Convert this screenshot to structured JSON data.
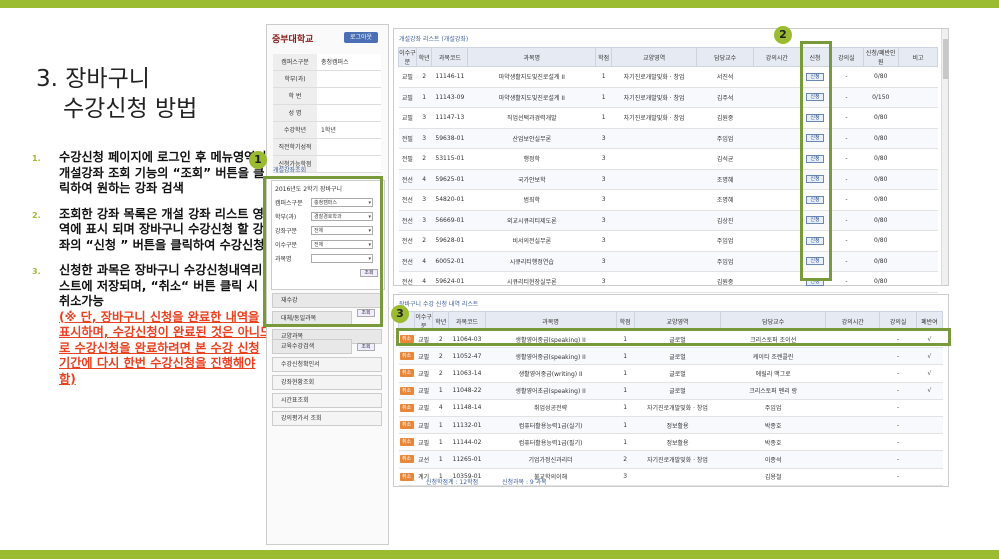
{
  "slide": {
    "title_line1": "3. 장바구니",
    "title_line2": "수강신청 방법",
    "steps": [
      {
        "num": "1.",
        "text": "수강신청 페이지에 로그인 후 메뉴영역의 개설강좌   조회 기능의 “조회” 버튼을 클릭하여 원하는 강좌 검색"
      },
      {
        "num": "2.",
        "text": "조회한 강좌 목록은 개설   강좌 리스트 영역에 표시   되며 장바구니 수강신청 할 강좌의 “신청 ” 버튼을 클릭하여 수강신청"
      },
      {
        "num": "3.",
        "text": "신청한 과목은 장바구니 수강신청내역리스트에 저장되며, “취소“ 버튼 클릭 시 취소가능",
        "note": "(※ 단, 장바구니 신청을 완료한 내역을 표시하며, 수강신청이 완료된 것은 아니므로 수강신청을 완료하려면 본 수강 신청 기간에 다시 한번 수강신청을 진행해야 함)"
      }
    ],
    "badges": [
      "1",
      "2",
      "3"
    ]
  },
  "portal": {
    "logo": "중부대학교",
    "logout": "로그아웃",
    "info": [
      {
        "k": "캠퍼스구분",
        "v": "충청캠퍼스"
      },
      {
        "k": "학부(과)",
        "v": ""
      },
      {
        "k": "학  번",
        "v": ""
      },
      {
        "k": "성  명",
        "v": ""
      },
      {
        "k": "수강학년",
        "v": "1학년"
      },
      {
        "k": "직전학기성적",
        "v": ""
      },
      {
        "k": "신청가능학점",
        "v": ""
      }
    ],
    "search_section": "개설강좌조회",
    "search_year": "2016년도 2학기 장바구니",
    "filters": [
      {
        "k": "캠퍼스구분",
        "v": "충청캠퍼스"
      },
      {
        "k": "학부(과)",
        "v": "경찰경호학과"
      },
      {
        "k": "강좌구분",
        "v": "전체"
      },
      {
        "k": "이수구분",
        "v": "전체"
      },
      {
        "k": "과목명",
        "v": ""
      }
    ],
    "search_btn": "조회",
    "menu": [
      "재수강",
      "대체/동일과목",
      "교양과목",
      "교육수강검색",
      "수강신청확인서",
      "강좌현황조회",
      "시간표조회",
      "강의평가서 조회"
    ]
  },
  "course_list": {
    "title": "개설강좌 리스트 (개설강좌)",
    "headers": [
      "이수구분",
      "학년",
      "과목코드",
      "과목명",
      "학점",
      "교양영역",
      "담당교수",
      "강의시간",
      "신청",
      "강의실",
      "신청/폐반인원",
      "비고"
    ],
    "apply_label": "신청",
    "rows": [
      [
        "교필",
        "2",
        "11146-11",
        "마약생활지도및진로설계 II",
        "1",
        "자기진로개발및화 · 창업",
        "서진석",
        "",
        "신청",
        "-",
        "0/80",
        ""
      ],
      [
        "교필",
        "1",
        "11143-09",
        "마약생활지도및진로설계 II",
        "1",
        "자기진로개발및화 · 창업",
        "김주석",
        "",
        "신청",
        "-",
        "0/150",
        ""
      ],
      [
        "교필",
        "3",
        "11147-13",
        "직업선택과경력개발",
        "1",
        "자기진로개발및화 · 창업",
        "김원중",
        "",
        "신청",
        "-",
        "0/80",
        ""
      ],
      [
        "전필",
        "3",
        "59638-01",
        "산업보안실무론",
        "3",
        "",
        "주임업",
        "",
        "신청",
        "-",
        "0/80",
        ""
      ],
      [
        "전필",
        "2",
        "53115-01",
        "행정학",
        "3",
        "",
        "김석균",
        "",
        "신청",
        "-",
        "0/80",
        ""
      ],
      [
        "전선",
        "4",
        "59625-01",
        "국가안보학",
        "3",
        "",
        "조명혜",
        "",
        "신청",
        "-",
        "0/80",
        ""
      ],
      [
        "전선",
        "3",
        "54820-01",
        "범죄학",
        "3",
        "",
        "조명혜",
        "",
        "신청",
        "-",
        "0/80",
        ""
      ],
      [
        "전선",
        "3",
        "56669-01",
        "외교시큐리티제도론",
        "3",
        "",
        "김상진",
        "",
        "신청",
        "-",
        "0/80",
        ""
      ],
      [
        "전선",
        "2",
        "59628-01",
        "비서의전실무론",
        "3",
        "",
        "주임업",
        "",
        "신청",
        "-",
        "0/80",
        ""
      ],
      [
        "전선",
        "4",
        "60052-01",
        "시큐리티행정연습",
        "3",
        "",
        "주임업",
        "",
        "신청",
        "-",
        "0/80",
        ""
      ],
      [
        "전선",
        "4",
        "59624-01",
        "시큐리티현장실무론",
        "3",
        "",
        "김원중",
        "",
        "신청",
        "-",
        "0/80",
        ""
      ]
    ]
  },
  "cart_list": {
    "title": "장바구니 수강 신청 내역 리스트",
    "headers": [
      "",
      "이수구분",
      "학년",
      "과목코드",
      "과목명",
      "학점",
      "교양영역",
      "담당교수",
      "강의시간",
      "강의실",
      "폐반여"
    ],
    "cancel_label": "취소",
    "rows": [
      [
        "교필",
        "2",
        "11064-03",
        "생활영어중급(speaking) II",
        "1",
        "글로벌",
        "크리스토퍼 조이선",
        "",
        "-",
        "√"
      ],
      [
        "교필",
        "2",
        "11052-47",
        "생활영어중급(speaking) II",
        "1",
        "글로벌",
        "케이티 조렌콜린",
        "",
        "-",
        "√"
      ],
      [
        "교필",
        "2",
        "11063-14",
        "생활영어중급(writing) II",
        "1",
        "글로벌",
        "에릴리 맥그로",
        "",
        "-",
        "√"
      ],
      [
        "교필",
        "1",
        "11048-22",
        "생활영어초급(speaking) II",
        "1",
        "글로벌",
        "크리스토퍼 펜리 랑",
        "",
        "-",
        "√"
      ],
      [
        "교필",
        "4",
        "11148-14",
        "취업성공전략",
        "1",
        "자기진로개발및화 · 창업",
        "주임업",
        "",
        "-",
        ""
      ],
      [
        "교필",
        "1",
        "11132-01",
        "컴퓨터활용능력1급(실기)",
        "1",
        "정보활용",
        "박종호",
        "",
        "-",
        ""
      ],
      [
        "교필",
        "1",
        "11144-02",
        "컴퓨터활용능력1급(필기)",
        "1",
        "정보활용",
        "박종호",
        "",
        "-",
        ""
      ],
      [
        "교선",
        "1",
        "11265-01",
        "기업가정신과리더",
        "2",
        "자기진로개발및화 · 창업",
        "이종석",
        "",
        "-",
        ""
      ],
      [
        "계기",
        "1",
        "10359-01",
        "불교학의이해",
        "3",
        "",
        "김용철",
        "",
        "-",
        ""
      ]
    ],
    "total_credits": "신청학점계 : 12학점",
    "total_courses": "신청과목 : 9 과목"
  }
}
